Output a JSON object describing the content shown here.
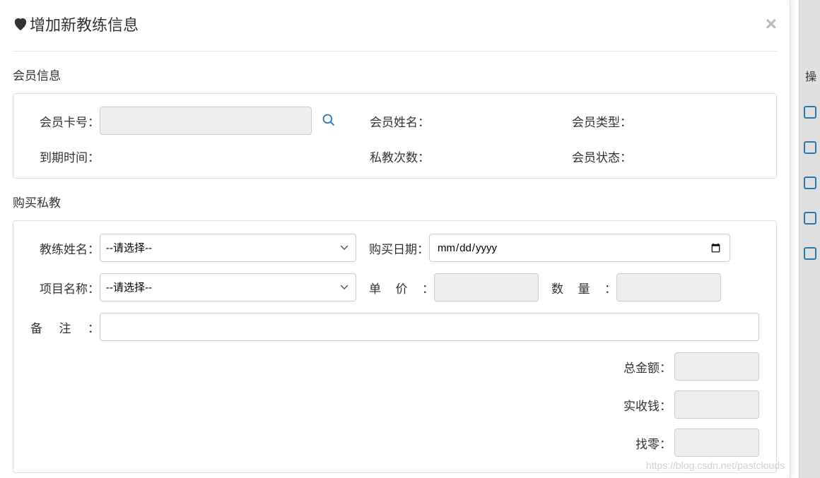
{
  "modal": {
    "title": "增加新教练信息",
    "close_symbol": "×"
  },
  "member_section": {
    "title": "会员信息",
    "card_no_label": "会员卡号：",
    "card_no_value": "",
    "name_label": "会员姓名：",
    "name_value": "",
    "type_label": "会员类型：",
    "type_value": "",
    "expire_label": "到期时间：",
    "expire_value": "",
    "pt_count_label": "私教次数：",
    "pt_count_value": "",
    "status_label": "会员状态：",
    "status_value": ""
  },
  "purchase_section": {
    "title": "购买私教",
    "coach_label": "教练姓名：",
    "coach_placeholder": "--请选择--",
    "purchase_date_label": "购买日期：",
    "date_placeholder": "年 /月/日",
    "project_label": "项目名称：",
    "project_placeholder": "--请选择--",
    "price_label_chars": [
      "单",
      "价"
    ],
    "price_value": "",
    "qty_label_chars": [
      "数",
      "量"
    ],
    "qty_value": "",
    "remark_label_chars": [
      "备",
      "注"
    ],
    "remark_value": "",
    "total_amount_label": "总金额：",
    "total_amount_value": "",
    "paid_label": "实收钱：",
    "paid_value": "",
    "change_label": "找零：",
    "change_value": ""
  },
  "watermark": "https://blog.csdn.net/pastclouds"
}
